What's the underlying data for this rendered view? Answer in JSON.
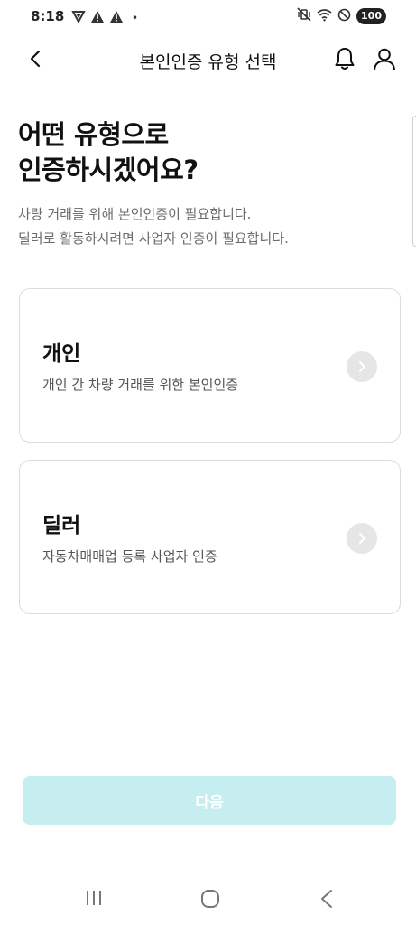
{
  "status_bar": {
    "time": "8:18",
    "dot": "•",
    "battery": "100",
    "left_icons": [
      "app-notification-icon",
      "warning-icon",
      "warning-icon"
    ],
    "right_icons": [
      "vibrate-mute-icon",
      "wifi-icon",
      "do-not-disturb-icon",
      "battery-icon"
    ]
  },
  "header": {
    "title": "본인인증 유형 선택",
    "icons": [
      "back-arrow-icon",
      "bell-icon",
      "person-icon"
    ]
  },
  "heading": {
    "line1": "어떤 유형으로",
    "line2": "인증하시겠어요?"
  },
  "subtext": {
    "line1": "차량 거래를 위해 본인인증이 필요합니다.",
    "line2": "딜러로 활동하시려면 사업자 인증이 필요합니다."
  },
  "options": [
    {
      "title": "개인",
      "description": "개인 간 차량 거래를 위한 본인인증"
    },
    {
      "title": "딜러",
      "description": "자동차매매업 등록 사업자 인증"
    }
  ],
  "next_button": {
    "label": "다음"
  },
  "colors": {
    "next_button_bg": "#c6eef0",
    "card_border": "#dcdcdc",
    "arrow_circle": "#e6e6e6"
  }
}
